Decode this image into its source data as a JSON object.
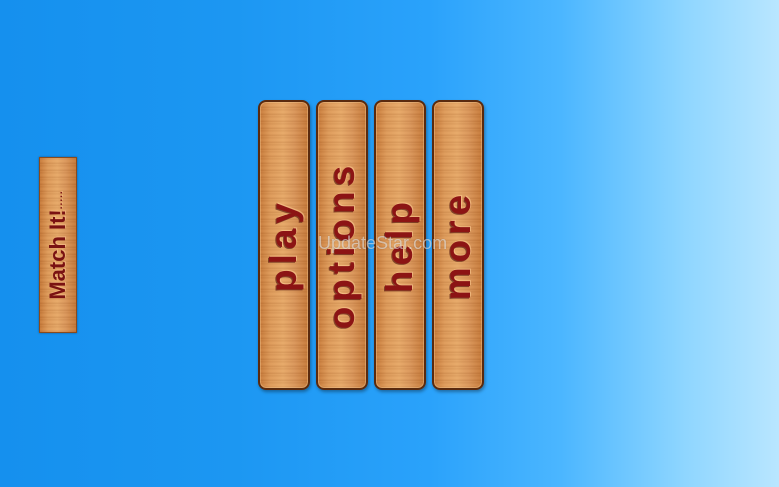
{
  "game": {
    "logo": {
      "title": "Match It!",
      "dots": "....."
    },
    "menu": {
      "play_label": "play",
      "options_label": "options",
      "help_label": "help",
      "more_label": "more"
    }
  },
  "watermark": {
    "text": "UpdateStar.com"
  },
  "colors": {
    "background_left": "#1590ee",
    "background_right": "#b9e6ff",
    "wood": "#dd9a5a",
    "label_text": "#8c1414"
  }
}
